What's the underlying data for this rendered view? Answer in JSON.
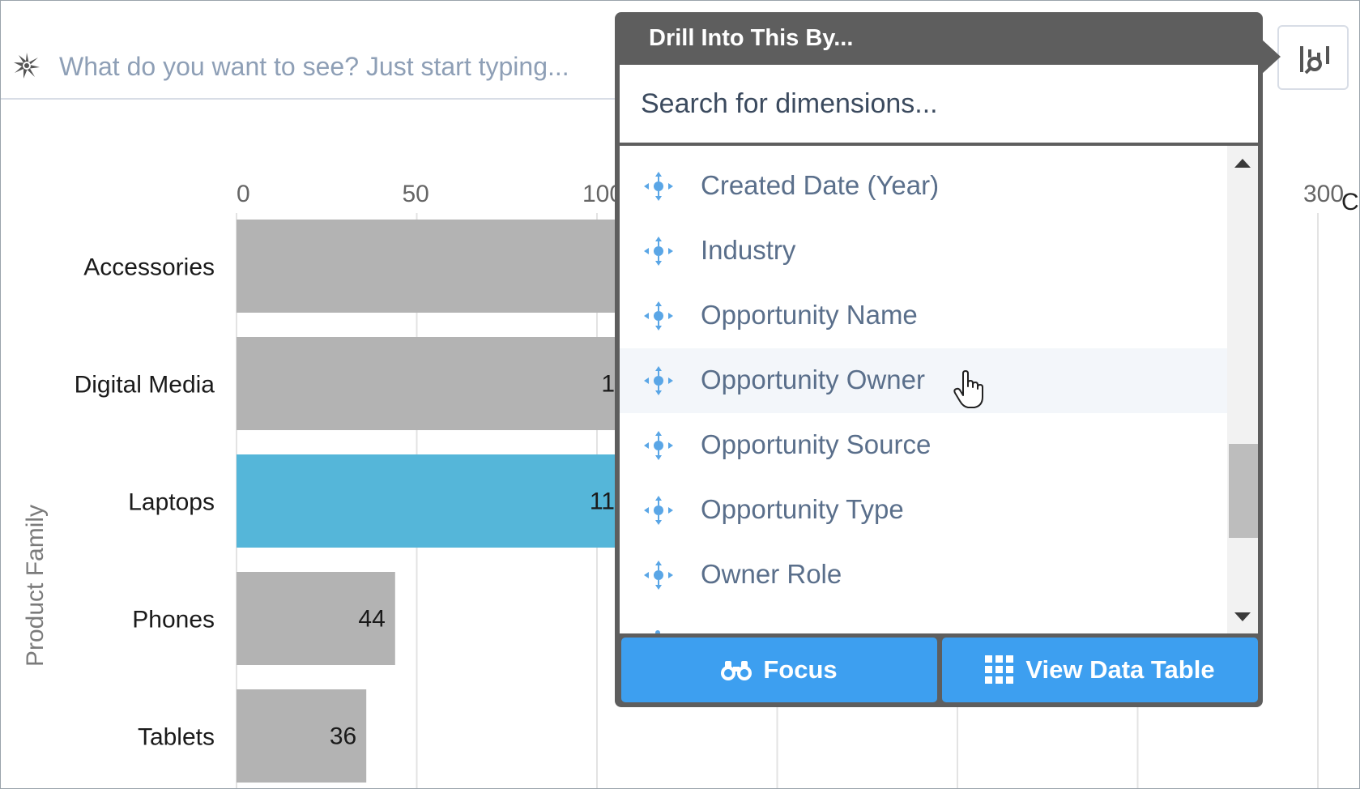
{
  "search": {
    "placeholder": "What do you want to see? Just start typing..."
  },
  "chart_data": {
    "type": "bar",
    "orientation": "horizontal",
    "categories": [
      "Accessories",
      "Digital Media",
      "Laptops",
      "Phones",
      "Tablets"
    ],
    "values": [
      null,
      null,
      null,
      44,
      36
    ],
    "visible_value_labels": [
      "",
      "1",
      "11",
      "44",
      "36"
    ],
    "highlighted_category": "Laptops",
    "x_ticks": [
      "0",
      "50",
      "100",
      "300"
    ],
    "x_cutoff_label": "Co",
    "ylabel": "Product Family",
    "colors": {
      "default": "#b3b3b3",
      "highlight": "#55b6d9",
      "grid": "#e3e3e3"
    }
  },
  "popover": {
    "title": "Drill Into This By...",
    "search_placeholder": "Search for dimensions...",
    "items": [
      {
        "label": "Created Date (Year)"
      },
      {
        "label": "Industry"
      },
      {
        "label": "Opportunity Name"
      },
      {
        "label": "Opportunity Owner",
        "hovered": true
      },
      {
        "label": "Opportunity Source"
      },
      {
        "label": "Opportunity Type"
      },
      {
        "label": "Owner Role"
      }
    ],
    "focus_label": "Focus",
    "table_label": "View Data Table",
    "accent_color": "#3d9ff0",
    "icon_color": "#5aa6e6",
    "item_icon": "dimension-move-icon"
  }
}
